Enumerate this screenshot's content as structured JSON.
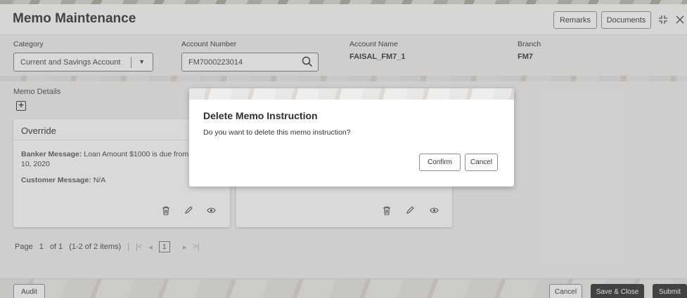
{
  "header": {
    "title": "Memo Maintenance",
    "remarks_label": "Remarks",
    "documents_label": "Documents",
    "minimize_icon": "collapse-icon",
    "close_icon": "close-icon"
  },
  "fields": {
    "category_label": "Category",
    "category_value": "Current and Savings Account",
    "account_number_label": "Account Number",
    "account_number_value": "FM7000223014",
    "account_name_label": "Account Name",
    "account_name_value": "FAISAL_FM7_1",
    "branch_label": "Branch",
    "branch_value": "FM7"
  },
  "memo_details": {
    "label": "Memo Details",
    "add_icon": "add-icon",
    "card1": {
      "title": "Override",
      "banker_label": "Banker Message:",
      "banker_value": " Loan Amount $1000 is due from",
      "banker_value_line2": "10, 2020",
      "customer_label": "Customer Message:",
      "customer_value": " N/A"
    }
  },
  "pager": {
    "page_label": "Page",
    "current": "1",
    "of_label": "of 1",
    "items_label": "(1-2 of 2 items)",
    "page_box": "1"
  },
  "footer": {
    "audit_label": "Audit",
    "cancel_label": "Cancel",
    "save_close_label": "Save & Close",
    "submit_label": "Submit"
  },
  "dialog": {
    "title": "Delete Memo Instruction",
    "message": "Do you want to delete this memo instruction?",
    "confirm_label": "Confirm",
    "cancel_label": "Cancel"
  },
  "colors": {
    "primary_dark": "#2f2f2f",
    "background": "#f1f0ee"
  }
}
